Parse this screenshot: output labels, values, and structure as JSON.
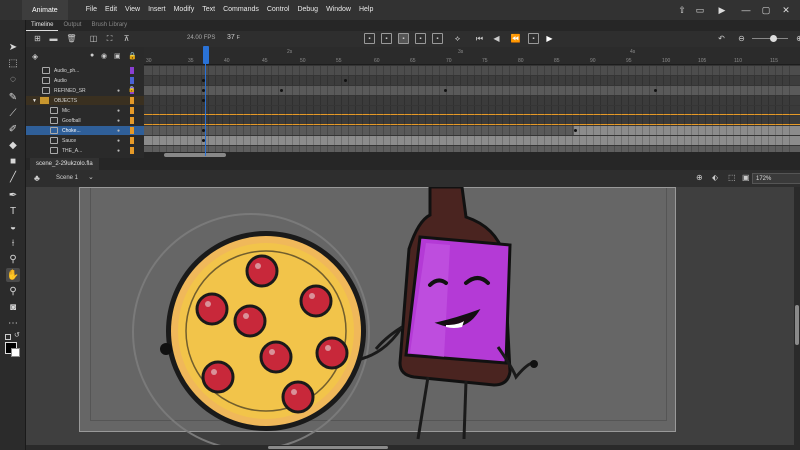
{
  "app": {
    "tab_label": "Animate"
  },
  "menu": [
    "File",
    "Edit",
    "View",
    "Insert",
    "Modify",
    "Text",
    "Commands",
    "Control",
    "Debug",
    "Window",
    "Help"
  ],
  "panel_tabs": [
    "Timeline",
    "Output",
    "Brush Library"
  ],
  "timeline": {
    "fps_value": "24.00",
    "fps_unit": "FPS",
    "current_frame": "37",
    "frame_unit": "F",
    "ruler_numbers": [
      "30",
      "35",
      "40",
      "45",
      "50",
      "55",
      "60",
      "65",
      "70",
      "75",
      "80",
      "85",
      "90",
      "95",
      "100",
      "105",
      "110",
      "115"
    ],
    "ruler_seconds": [
      "2s",
      "3s",
      "4s"
    ],
    "layers": [
      {
        "name": "Audio_ph...",
        "color": "#8a3fd1"
      },
      {
        "name": "Audio",
        "color": "#4a62d6"
      },
      {
        "name": "REFINED_SR",
        "color": "#8a3fd1"
      },
      {
        "name": "OBJECTS",
        "color": "#e69a28"
      },
      {
        "name": "Mic",
        "color": "#e69a28"
      },
      {
        "name": "Goofball",
        "color": "#e69a28"
      },
      {
        "name": "Choke...",
        "color": "#e69a28"
      },
      {
        "name": "Sauce",
        "color": "#e69a28"
      },
      {
        "name": "THE_A...",
        "color": "#e69a28"
      }
    ]
  },
  "document": {
    "tab_label": "scene_2-29ukzolo.fla",
    "scene_label": "Scene 1",
    "zoom": "172%"
  },
  "colors": {
    "accent": "#2a72d6",
    "pizza_crust": "#f2c44a",
    "pepperoni": "#c8283a",
    "bottle_brown": "#4a2420",
    "label_purple": "#b43ad6"
  }
}
